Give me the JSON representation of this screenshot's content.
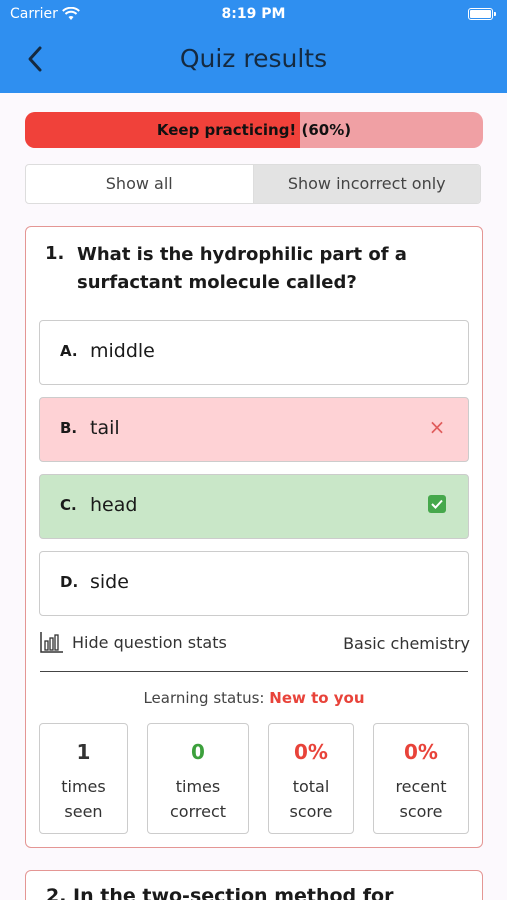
{
  "status_bar": {
    "carrier": "Carrier",
    "time": "8:19 PM"
  },
  "nav": {
    "title": "Quiz results"
  },
  "progress": {
    "label": "Keep practicing! (60%)",
    "percent": 60,
    "fill_color": "#f0413a"
  },
  "filter": {
    "show_all": "Show all",
    "show_incorrect": "Show incorrect only",
    "selected": "Show incorrect only"
  },
  "question": {
    "number": "1.",
    "text": "What is the hydrophilic part of a surfactant molecule called?",
    "options": [
      {
        "letter": "A.",
        "text": "middle",
        "state": "neutral"
      },
      {
        "letter": "B.",
        "text": "tail",
        "state": "incorrect"
      },
      {
        "letter": "C.",
        "text": "head",
        "state": "correct"
      },
      {
        "letter": "D.",
        "text": "side",
        "state": "neutral"
      }
    ],
    "hide_stats_label": "Hide question stats",
    "topic": "Basic chemistry",
    "learning_status_label": "Learning status:",
    "learning_status_value": "New to you",
    "stats": [
      {
        "value": "1",
        "label_line1": "times",
        "label_line2": "seen"
      },
      {
        "value": "0",
        "label_line1": "times",
        "label_line2": "correct"
      },
      {
        "value": "0%",
        "label_line1": "total",
        "label_line2": "score"
      },
      {
        "value": "0%",
        "label_line1": "recent",
        "label_line2": "score"
      }
    ]
  },
  "next_question": {
    "text": "2.   In the two-section method for"
  }
}
